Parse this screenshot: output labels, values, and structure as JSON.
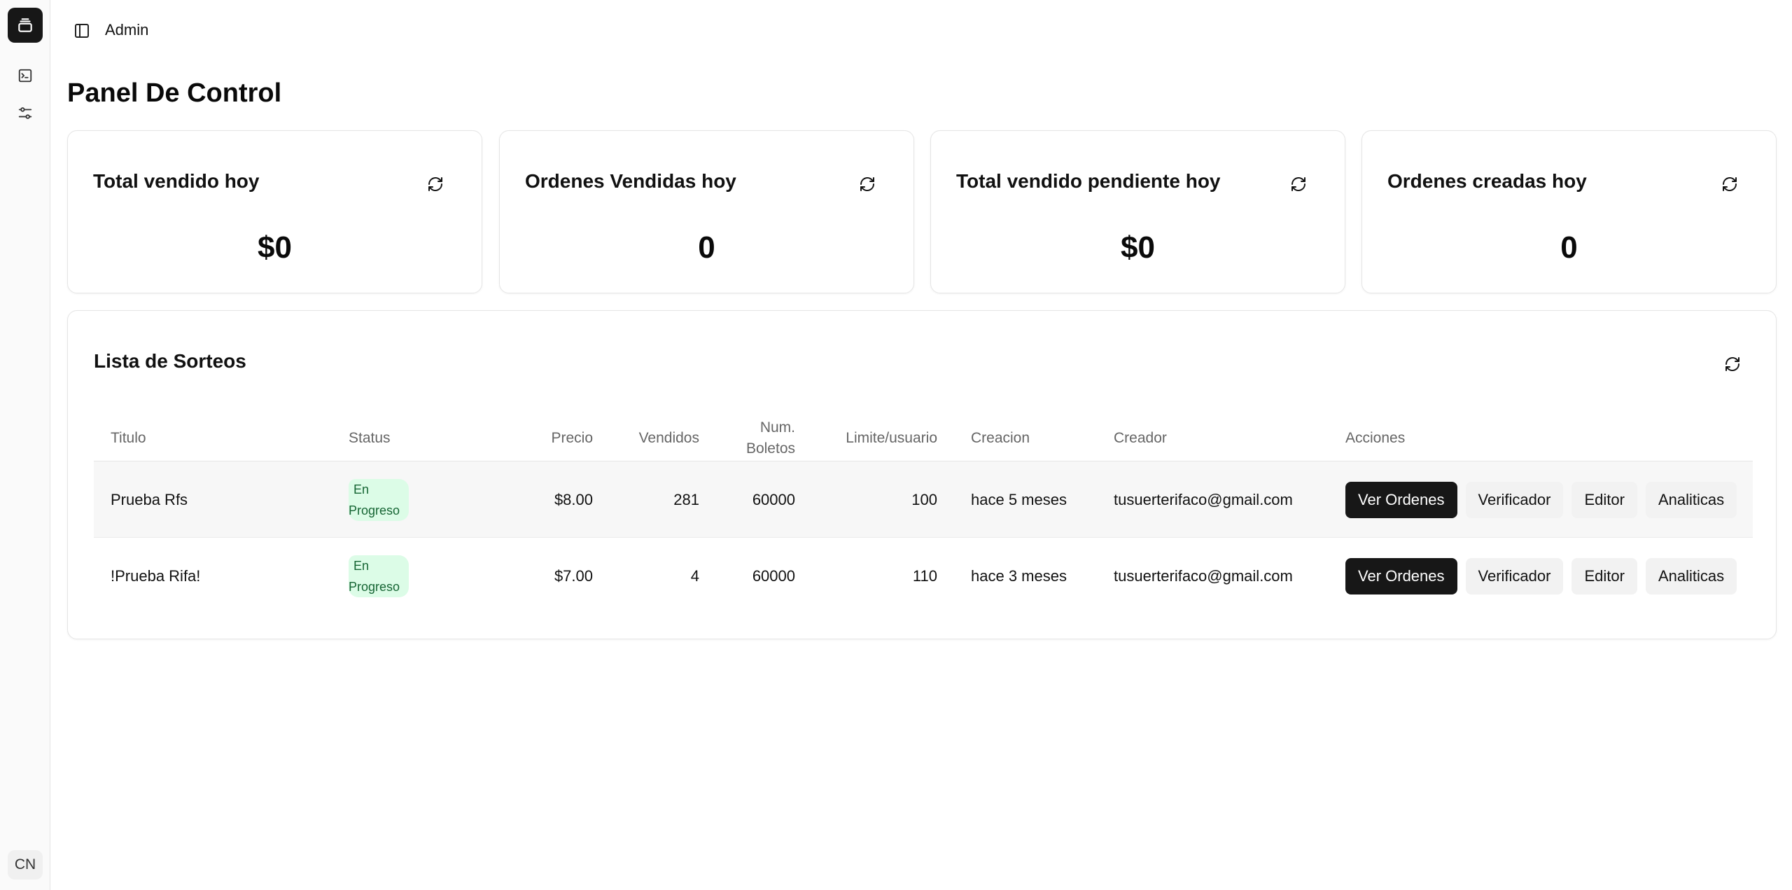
{
  "rail": {
    "logo_icon": "stack-icon",
    "items": [
      {
        "icon": "terminal-icon"
      },
      {
        "icon": "sliders-icon"
      }
    ],
    "avatar_initials": "CN"
  },
  "header": {
    "toggle_icon": "sidebar-icon",
    "title": "Admin"
  },
  "page": {
    "title": "Panel De Control"
  },
  "stats": [
    {
      "title": "Total vendido hoy",
      "value": "$0"
    },
    {
      "title": "Ordenes Vendidas hoy",
      "value": "0"
    },
    {
      "title": "Total vendido pendiente hoy",
      "value": "$0"
    },
    {
      "title": "Ordenes creadas hoy",
      "value": "0"
    }
  ],
  "raffles": {
    "title": "Lista de Sorteos",
    "columns": {
      "titulo": "Titulo",
      "status": "Status",
      "precio": "Precio",
      "vendidos": "Vendidos",
      "boletos_l1": "Num.",
      "boletos_l2": "Boletos",
      "limite": "Limite/usuario",
      "creacion": "Creacion",
      "creador": "Creador",
      "acciones": "Acciones"
    },
    "rows": [
      {
        "titulo": "Prueba Rfs",
        "status_l1": "En",
        "status_l2": "Progreso",
        "precio": "$8.00",
        "vendidos": "281",
        "boletos": "60000",
        "limite": "100",
        "creacion": "hace 5 meses",
        "creador": "tusuerterifaco@gmail.com"
      },
      {
        "titulo": "!Prueba Rifa!",
        "status_l1": "En",
        "status_l2": "Progreso",
        "precio": "$7.00",
        "vendidos": "4",
        "boletos": "60000",
        "limite": "110",
        "creacion": "hace 3 meses",
        "creador": "tusuerterifaco@gmail.com"
      }
    ],
    "actions": {
      "ver_ordenes": "Ver Ordenes",
      "verificador": "Verificador",
      "editor": "Editor",
      "analiticas": "Analiticas"
    }
  },
  "colors": {
    "primary": "#171717",
    "badge_bg": "#dcfce7",
    "badge_text": "#166534",
    "border": "#e5e5e5"
  }
}
